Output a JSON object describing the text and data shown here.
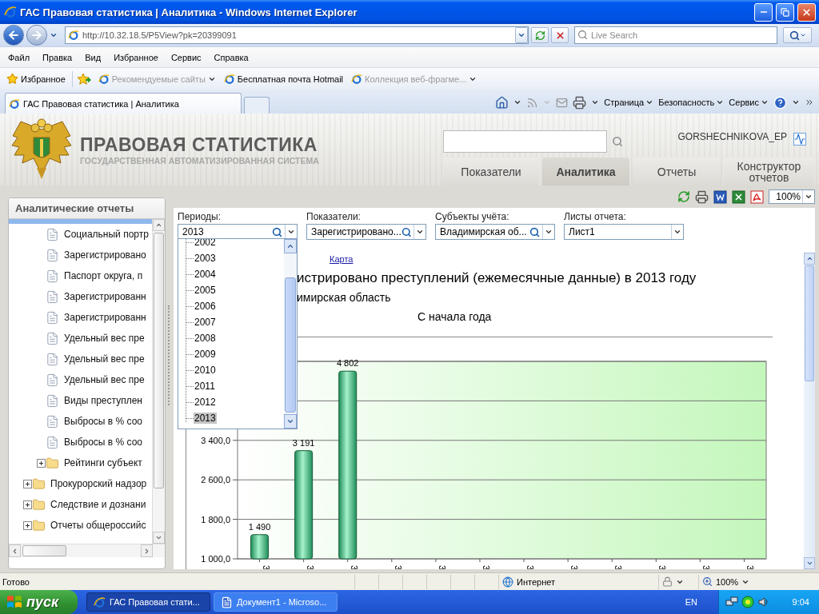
{
  "window": {
    "title": "ГАС Правовая статистика | Аналитика - Windows Internet Explorer"
  },
  "address_bar": {
    "url": "http://10.32.18.5/P5View?pk=20399091",
    "search_placeholder": "Live Search"
  },
  "menu": [
    "Файл",
    "Правка",
    "Вид",
    "Избранное",
    "Сервис",
    "Справка"
  ],
  "favorites_bar": {
    "favorites": "Избранное",
    "links": [
      {
        "label": "Рекомендуемые сайты",
        "disabled": true,
        "dropdown": true
      },
      {
        "label": "Бесплатная почта Hotmail",
        "disabled": false,
        "dropdown": false
      },
      {
        "label": "Коллекция веб-фрагме...",
        "disabled": true,
        "dropdown": true
      }
    ]
  },
  "browser_tabs": [
    {
      "label": "ГАС Правовая статистика | Аналитика",
      "selected": true
    }
  ],
  "command_bar": [
    "Страница",
    "Безопасность",
    "Сервис"
  ],
  "site": {
    "title": "ПРАВОВАЯ СТАТИСТИКА",
    "subtitle": "ГОСУДАРСТВЕННАЯ АВТОМАТИЗИРОВАННАЯ СИСТЕМА",
    "user": "GORSHECHNIKOVA_EP",
    "tabs": [
      {
        "label": "Показатели",
        "selected": false
      },
      {
        "label": "Аналитика",
        "selected": true
      },
      {
        "label": "Отчеты",
        "selected": false
      },
      {
        "label": "Конструктор отчетов",
        "selected": false
      }
    ]
  },
  "sidebar": {
    "title": "Аналитические отчеты",
    "tree": [
      {
        "kind": "folder",
        "selected": true,
        "expanded": true,
        "children": [
          {
            "kind": "report",
            "label": "Социальный портр",
            "selected": false
          },
          {
            "kind": "report",
            "label": "Зарегистрировано",
            "selected": false
          },
          {
            "kind": "report",
            "label": "Паспорт округа, п",
            "selected": false
          },
          {
            "kind": "report",
            "label": "Зарегистрированн",
            "selected": false
          },
          {
            "kind": "report",
            "label": "Зарегистрированн",
            "selected": false
          },
          {
            "kind": "report",
            "label": "Удельный вес пре",
            "selected": false
          },
          {
            "kind": "report",
            "label": "Удельный вес пре",
            "selected": false
          },
          {
            "kind": "report",
            "label": "Удельный вес пре",
            "selected": false
          },
          {
            "kind": "report",
            "label": "Виды преступлен",
            "selected": false
          },
          {
            "kind": "report",
            "label": "Выбросы в % соо",
            "selected": false
          },
          {
            "kind": "report",
            "label": "Выбросы в % соо",
            "selected": false
          },
          {
            "kind": "folder",
            "label": "Рейтинги субъект",
            "selected": false,
            "expanded": false
          }
        ]
      },
      {
        "kind": "folder",
        "label": "Прокурорский надзор",
        "selected": false,
        "expanded": false
      },
      {
        "kind": "folder",
        "label": "Следствие и дознани",
        "selected": false,
        "expanded": false
      },
      {
        "kind": "folder",
        "label": "Отчеты общероссийс",
        "selected": false,
        "expanded": false
      }
    ]
  },
  "toolbar": {
    "zoom": "100%"
  },
  "filters": [
    {
      "label": "Периоды:",
      "value": "2013",
      "kind": "search"
    },
    {
      "label": "Показатели:",
      "value": "Зарегистрировано...",
      "kind": "search"
    },
    {
      "label": "Субъекты учёта:",
      "value": "Владимирская об...",
      "kind": "search"
    },
    {
      "label": "Листы отчета:",
      "value": "Лист1",
      "kind": "select"
    }
  ],
  "period_dropdown": {
    "options": [
      {
        "label": "2002",
        "selected": false
      },
      {
        "label": "2003",
        "selected": false
      },
      {
        "label": "2004",
        "selected": false
      },
      {
        "label": "2005",
        "selected": false
      },
      {
        "label": "2006",
        "selected": false
      },
      {
        "label": "2007",
        "selected": false
      },
      {
        "label": "2008",
        "selected": false
      },
      {
        "label": "2009",
        "selected": false
      },
      {
        "label": "2010",
        "selected": false
      },
      {
        "label": "2011",
        "selected": false
      },
      {
        "label": "2012",
        "selected": false
      },
      {
        "label": "2013",
        "selected": true
      }
    ]
  },
  "report": {
    "link": "Карта",
    "title": "истрировано преступлений (ежемесячные данные) в 2013 году",
    "subtitle": "имирская область",
    "chart_data": {
      "type": "bar",
      "title": "С начала года",
      "categories": [
        "3",
        "3",
        "3",
        "3",
        "3",
        "3",
        "3",
        "3",
        "3",
        "3",
        "3",
        "3"
      ],
      "values": [
        1490,
        3191,
        4802,
        null,
        null,
        null,
        null,
        null,
        null,
        null,
        null,
        null
      ],
      "value_labels": [
        "1 490",
        "3 191",
        "4 802",
        null,
        null,
        null,
        null,
        null,
        null,
        null,
        null,
        null
      ],
      "ylim": [
        1000,
        5000
      ],
      "grid": true,
      "yticks": [
        {
          "value": 1000,
          "label": "1 000,0"
        },
        {
          "value": 1800,
          "label": "1 800,0"
        },
        {
          "value": 2600,
          "label": "2 600,0"
        },
        {
          "value": 3400,
          "label": "3 400,0"
        }
      ]
    }
  },
  "status_bar": {
    "text": "Готово",
    "zone": "Интернет",
    "zoom": "100%"
  },
  "taskbar": {
    "start": "пуск",
    "tasks": [
      {
        "label": "ГАС Правовая стати...",
        "selected": true,
        "kind": "browser"
      },
      {
        "label": "Документ1 - Microso...",
        "selected": false,
        "kind": "document"
      }
    ],
    "language": "EN",
    "clock": "9:04"
  }
}
